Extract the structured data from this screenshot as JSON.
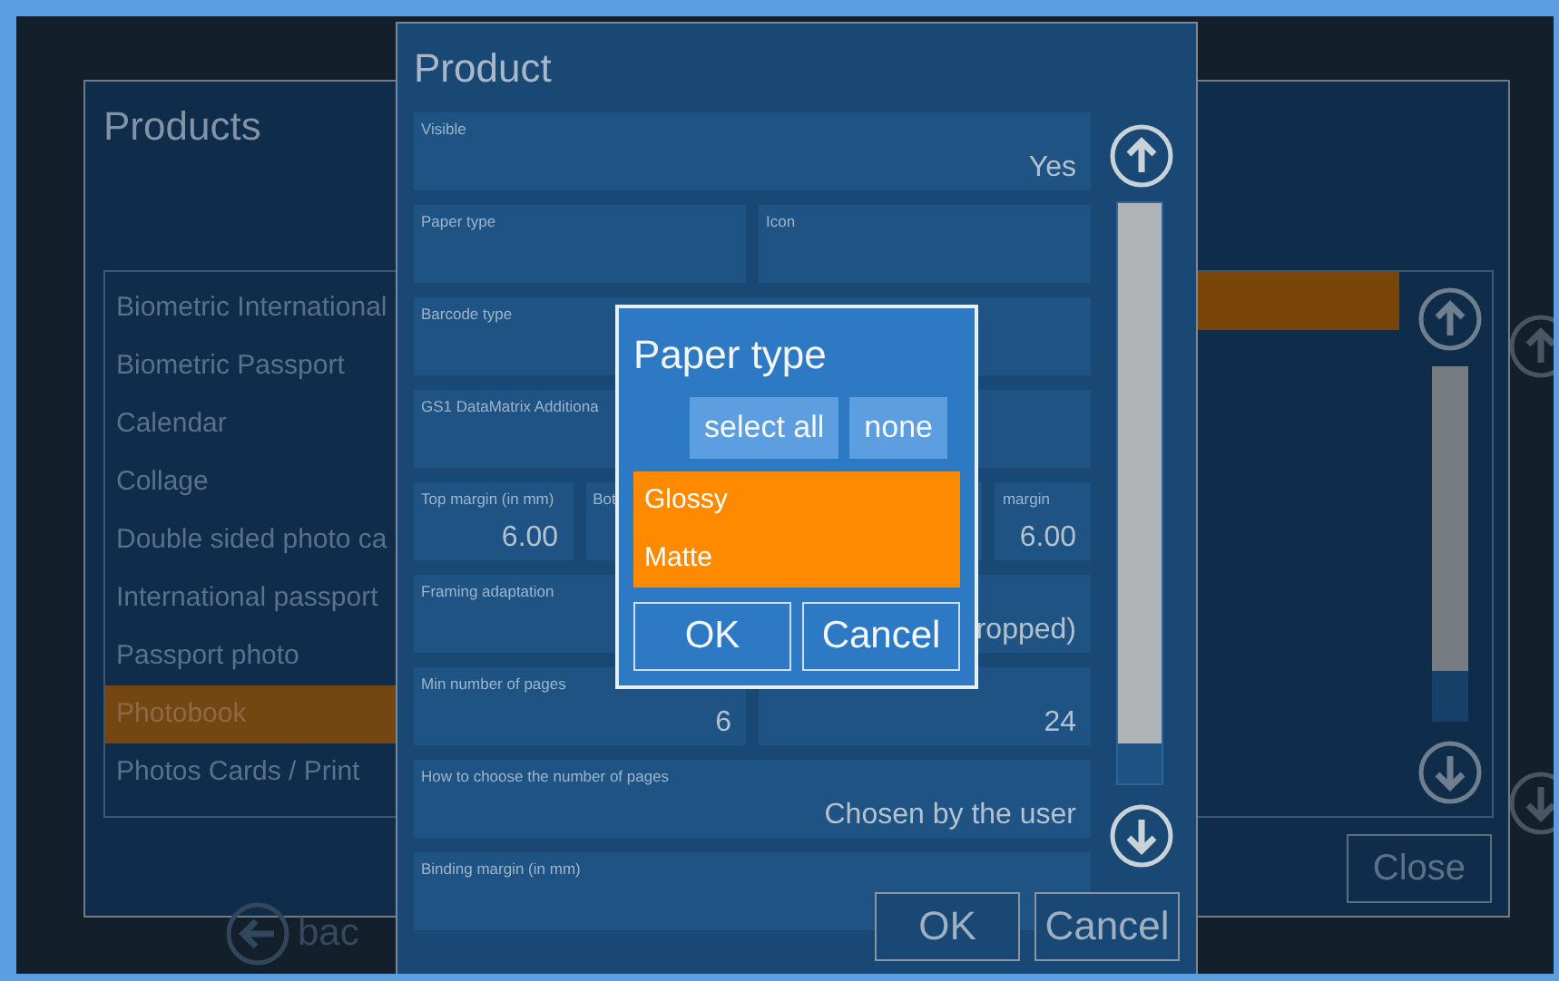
{
  "products_window": {
    "title": "Products",
    "items": [
      {
        "label": "Biometric International",
        "selected": false
      },
      {
        "label": "Biometric Passport",
        "selected": false
      },
      {
        "label": "Calendar",
        "selected": false
      },
      {
        "label": "Collage",
        "selected": false
      },
      {
        "label": "Double sided photo ca",
        "selected": false
      },
      {
        "label": "International passport",
        "selected": false
      },
      {
        "label": "Passport photo",
        "selected": false
      },
      {
        "label": "Photobook",
        "selected": true
      },
      {
        "label": "Photos Cards / Print",
        "selected": false
      }
    ],
    "detail_list": {
      "items": [
        {
          "selected": true
        }
      ]
    },
    "close_button": "Close"
  },
  "back_button": "bac",
  "product_dialog": {
    "title": "Product",
    "rows": [
      {
        "fields": [
          {
            "label": "Visible",
            "value": "Yes"
          }
        ]
      },
      {
        "fields": [
          {
            "label": "Paper type"
          },
          {
            "label": "Icon"
          }
        ]
      },
      {
        "fields": [
          {
            "label": "Barcode type"
          }
        ]
      },
      {
        "fields": [
          {
            "label": "GS1 DataMatrix Additiona"
          }
        ]
      },
      {
        "fields": [
          {
            "label": "Top margin (in mm)",
            "value": "6.00"
          },
          {
            "label": "Bot"
          },
          {
            "label": "margin",
            "value": "6.00"
          }
        ]
      },
      {
        "fields": [
          {
            "label": "Framing adaptation",
            "value": "ropped)"
          }
        ]
      },
      {
        "fields": [
          {
            "label": "Min number of pages",
            "value": "6"
          },
          {
            "value": "24"
          }
        ]
      },
      {
        "fields": [
          {
            "label": "How to choose the number of pages",
            "value": "Chosen by the user"
          }
        ]
      },
      {
        "fields": [
          {
            "label": "Binding margin (in mm)"
          }
        ]
      }
    ],
    "buttons": [
      "OK",
      "Cancel"
    ]
  },
  "paper_type_popup": {
    "title": "Paper type",
    "select_all": "select all",
    "none": "none",
    "options": [
      {
        "label": "Glossy",
        "selected": true
      },
      {
        "label": "Matte",
        "selected": true
      }
    ],
    "buttons": [
      "OK",
      "Cancel"
    ]
  }
}
